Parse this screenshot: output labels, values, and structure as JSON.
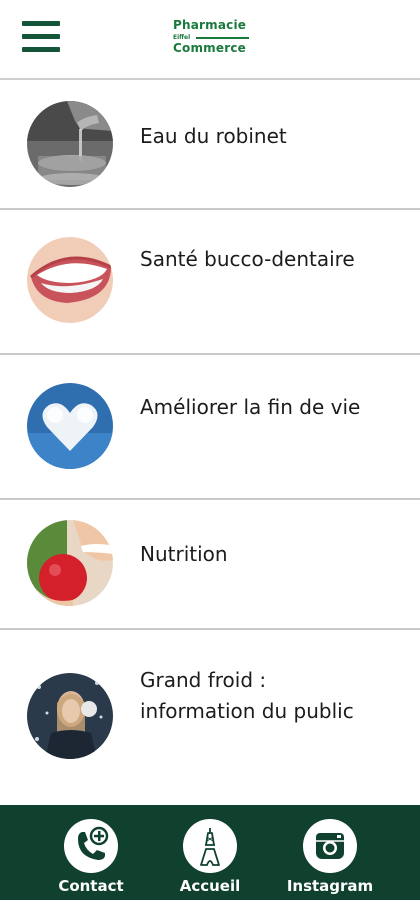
{
  "header": {
    "logo_line1": "Pharmacie",
    "logo_line2": "Eiffel",
    "logo_line3": "Commerce",
    "menu_icon": "hamburger-menu-icon"
  },
  "items": [
    {
      "label": "Eau du robinet",
      "image": "tap-water-glass"
    },
    {
      "label": "Santé bucco-dentaire",
      "image": "smiling-teeth"
    },
    {
      "label": "Améliorer la fin de vie",
      "image": "heart-shaped-cloud"
    },
    {
      "label": "Nutrition",
      "image": "apple-and-smile"
    },
    {
      "label": "Grand froid : information du public",
      "image": "woman-in-snow-earmuffs"
    }
  ],
  "bottom_nav": [
    {
      "label": "Contact",
      "icon": "phone-plus-icon"
    },
    {
      "label": "Accueil",
      "icon": "eiffel-tower-icon"
    },
    {
      "label": "Instagram",
      "icon": "instagram-icon"
    }
  ],
  "colors": {
    "brand_green": "#1a7a3e",
    "dark_green": "#10402e",
    "menu_green": "#14553a",
    "divider": "#c9c9c9"
  }
}
